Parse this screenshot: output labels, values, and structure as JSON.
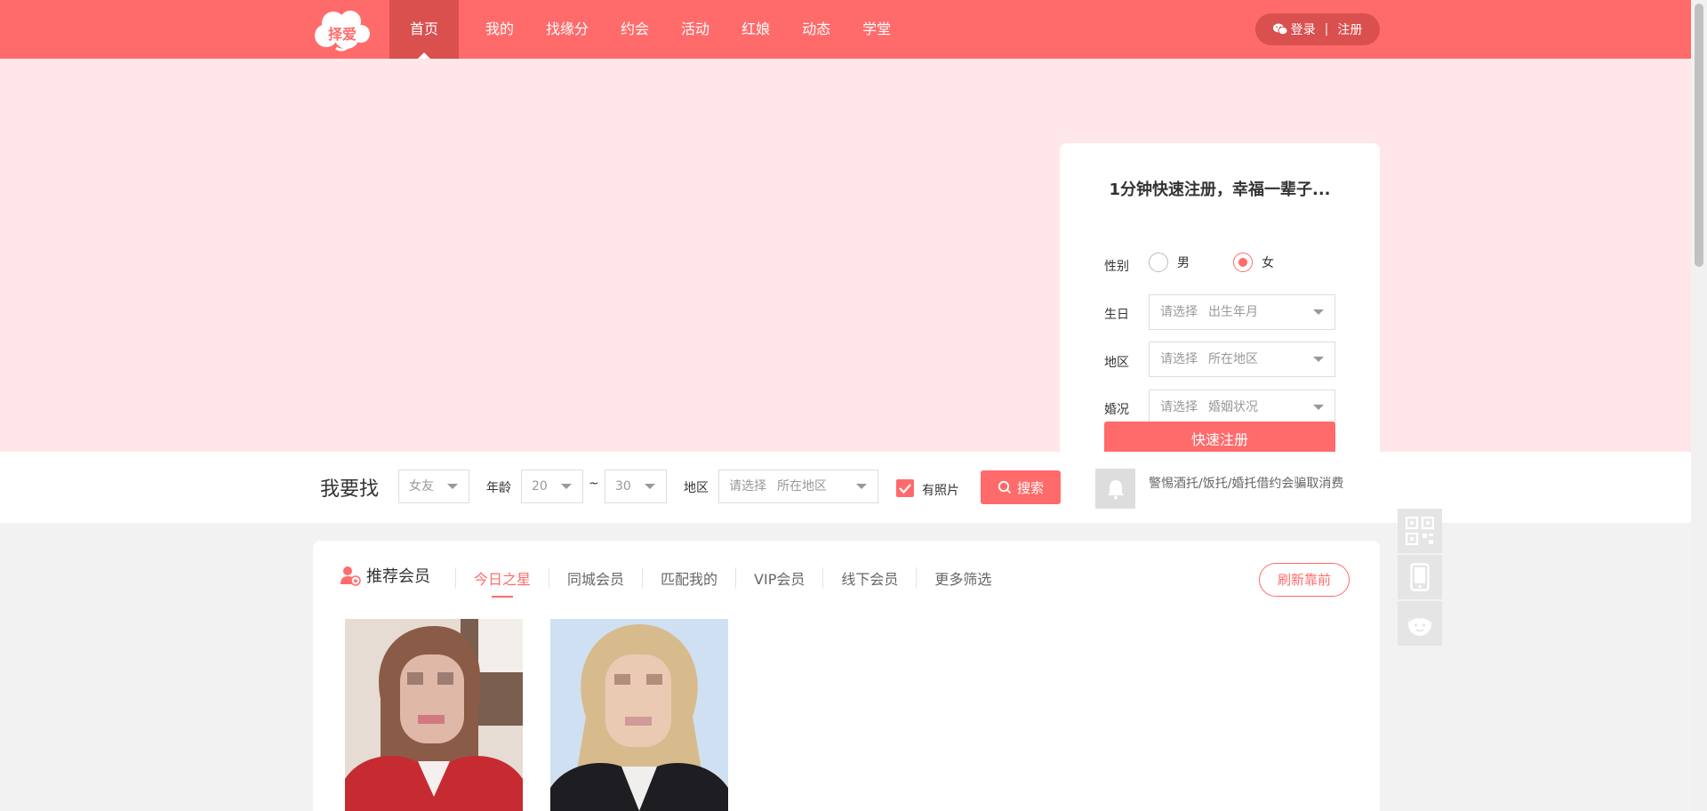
{
  "brand": {
    "logo_text": "择爱",
    "primary_color": "#ff6b6b",
    "dark_color": "#d9504f",
    "banner_color": "#ffe6e9"
  },
  "nav": {
    "items": [
      {
        "label": "首页",
        "active": true
      },
      {
        "label": "我的"
      },
      {
        "label": "找缘分"
      },
      {
        "label": "约会"
      },
      {
        "label": "活动"
      },
      {
        "label": "红娘"
      },
      {
        "label": "动态"
      },
      {
        "label": "学堂"
      }
    ]
  },
  "auth": {
    "login": "登录",
    "separator": "|",
    "register": "注册"
  },
  "register_card": {
    "title": "1分钟快速注册，幸福一辈子...",
    "gender_label": "性别",
    "gender_options": [
      "男",
      "女"
    ],
    "gender_selected": "女",
    "birthday": {
      "label": "生日",
      "placeholder": "请选择",
      "hint": "出生年月"
    },
    "region": {
      "label": "地区",
      "placeholder": "请选择",
      "hint": "所在地区"
    },
    "marital": {
      "label": "婚况",
      "placeholder": "请选择",
      "hint": "婚姻状况"
    },
    "submit": "快速注册"
  },
  "search": {
    "title": "我要找",
    "target": "女友",
    "age_label": "年龄",
    "age_min": "20",
    "age_sep": "~",
    "age_max": "30",
    "region_label": "地区",
    "region_placeholder": "请选择",
    "region_hint": "所在地区",
    "photo_label": "有照片",
    "photo_checked": true,
    "button": "搜索",
    "notice": "警惕酒托/饭托/婚托借约会骗取消费"
  },
  "recommend": {
    "title": "推荐会员",
    "tabs": [
      "今日之星",
      "同城会员",
      "匹配我的",
      "VIP会员",
      "线下会员",
      "更多筛选"
    ],
    "active_tab": 0,
    "refresh": "刷新靠前"
  },
  "side_tools": [
    "qrcode-icon",
    "mobile-icon",
    "service-icon"
  ]
}
